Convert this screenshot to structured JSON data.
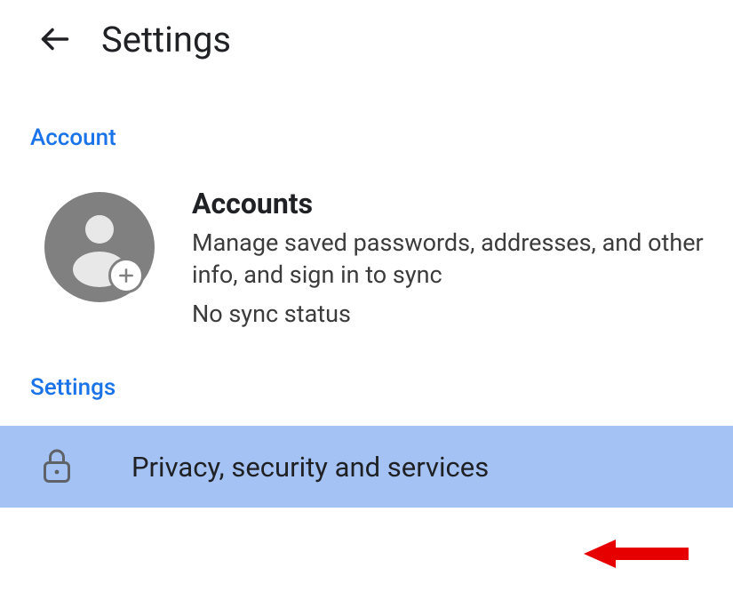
{
  "header": {
    "title": "Settings"
  },
  "sections": {
    "account": {
      "header": "Account",
      "item": {
        "title": "Accounts",
        "description": "Manage saved passwords, addresses, and other info, and sign in to sync",
        "sync_status": "No sync status"
      }
    },
    "settings": {
      "header": "Settings",
      "items": [
        {
          "label": "Privacy, security and services",
          "highlighted": true
        }
      ]
    }
  },
  "colors": {
    "accent": "#1a73e8",
    "highlight_bg": "#a4c2f4",
    "text_primary": "#202124",
    "text_secondary": "#3c3c3c",
    "avatar_bg": "#808080",
    "arrow": "#e60000"
  }
}
